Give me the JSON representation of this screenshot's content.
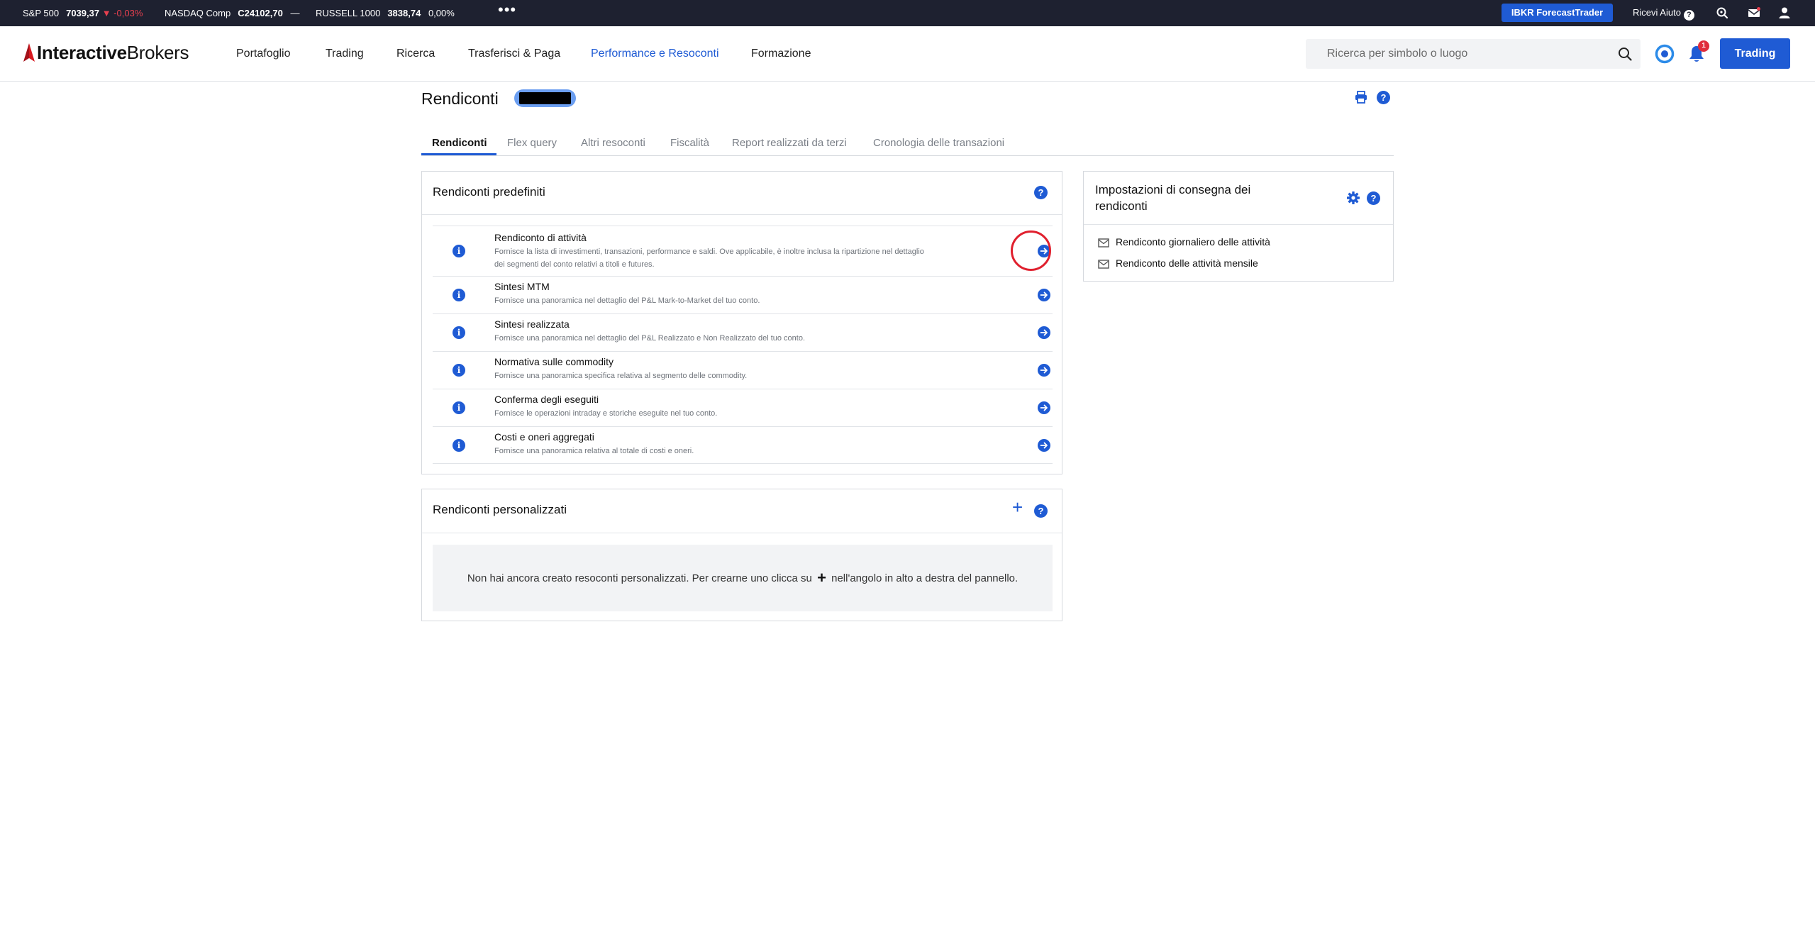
{
  "ticker": {
    "items": [
      {
        "name": "S&P 500",
        "value": "7039,37",
        "change": "-0,03%"
      },
      {
        "name": "NASDAQ Comp",
        "value": "C24102,70",
        "change": "—"
      },
      {
        "name": "RUSSELL 1000",
        "value": "3838,74",
        "change": "0,00%"
      }
    ],
    "more": "•••",
    "forecast_button": "IBKR ForecastTrader",
    "help_label": "Ricevi Aiuto",
    "help_glyph": "?"
  },
  "nav": {
    "logo_part1": "Interactive",
    "logo_part2": "Brokers",
    "menu": [
      "Portafoglio",
      "Trading",
      "Ricerca",
      "Trasferisci & Paga",
      "Performance e Resoconti",
      "Formazione"
    ],
    "active_menu": "Performance e Resoconti",
    "search_placeholder": "Ricerca per simbolo o luogo",
    "notification_count": "1",
    "trading_button": "Trading"
  },
  "page": {
    "title": "Rendiconti",
    "account_id": "██████"
  },
  "tabs": [
    "Rendiconti",
    "Flex query",
    "Altri resoconti",
    "Fiscalità",
    "Report realizzati da terzi",
    "Cronologia delle transazioni"
  ],
  "predefined": {
    "title": "Rendiconti predefiniti",
    "help_glyph": "?",
    "info_glyph": "i",
    "rows": [
      {
        "title": "Rendiconto di attività",
        "desc": "Fornisce la lista di investimenti, transazioni, performance e saldi. Ove applicabile, è inoltre inclusa la ripartizione nel dettaglio dei segmenti del conto relativi a titoli e futures."
      },
      {
        "title": "Sintesi MTM",
        "desc": "Fornisce una panoramica nel dettaglio del P&L Mark-to-Market del tuo conto."
      },
      {
        "title": "Sintesi realizzata",
        "desc": "Fornisce una panoramica nel dettaglio del P&L Realizzato e Non Realizzato del tuo conto."
      },
      {
        "title": "Normativa sulle commodity",
        "desc": "Fornisce una panoramica specifica relativa al segmento delle commodity."
      },
      {
        "title": "Conferma degli eseguiti",
        "desc": "Fornisce le operazioni intraday e storiche eseguite nel tuo conto."
      },
      {
        "title": "Costi e oneri aggregati",
        "desc": "Fornisce una panoramica relativa al totale di costi e oneri."
      }
    ]
  },
  "custom": {
    "title": "Rendiconti personalizzati",
    "add_glyph": "+",
    "help_glyph": "?",
    "empty_text_before": "Non hai ancora creato resoconti personalizzati. Per crearne uno clicca su",
    "empty_plus": "+",
    "empty_text_after": "nell'angolo in alto a destra del pannello."
  },
  "delivery": {
    "title_line1": "Impostazioni di consegna dei",
    "title_line2": "rendiconti",
    "help_glyph": "?",
    "items": [
      "Rendiconto giornaliero delle attività",
      "Rendiconto delle attività mensile"
    ]
  },
  "colors": {
    "accent": "#1f5bd4",
    "ticker_bg": "#1e2130",
    "negative": "#e8404f",
    "highlight_ring": "#e0202e"
  }
}
